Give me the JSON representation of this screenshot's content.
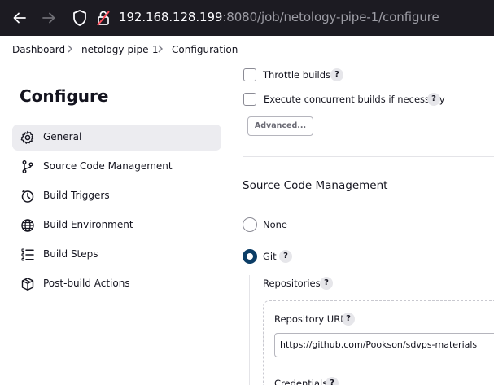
{
  "browser": {
    "url_host": "192.168.128.199",
    "url_rest": ":8080/job/netology-pipe-1/configure"
  },
  "breadcrumb": {
    "items": [
      "Dashboard",
      "netology-pipe-1",
      "Configuration"
    ]
  },
  "sidebar": {
    "title": "Configure",
    "items": [
      {
        "label": "General",
        "icon": "gear-icon",
        "active": true
      },
      {
        "label": "Source Code Management",
        "icon": "branch-icon"
      },
      {
        "label": "Build Triggers",
        "icon": "clock-icon"
      },
      {
        "label": "Build Environment",
        "icon": "globe-icon"
      },
      {
        "label": "Build Steps",
        "icon": "list-icon"
      },
      {
        "label": "Post-build Actions",
        "icon": "package-icon"
      }
    ]
  },
  "general": {
    "throttle_label": "Throttle builds",
    "concurrent_label": "Execute concurrent builds if necessary",
    "advanced_label": "Advanced..."
  },
  "scm": {
    "title": "Source Code Management",
    "none_label": "None",
    "git_label": "Git",
    "selected": "Git",
    "repositories_label": "Repositories",
    "repo_url_label": "Repository URL",
    "repo_url_value": "https://github.com/Pookson/sdvps-materials",
    "credentials_label": "Credentials"
  },
  "help_glyph": "?",
  "colors": {
    "browser_bar": "#1c1b22",
    "active_item": "#ececf0",
    "radio_checked": "#0b3d66"
  }
}
